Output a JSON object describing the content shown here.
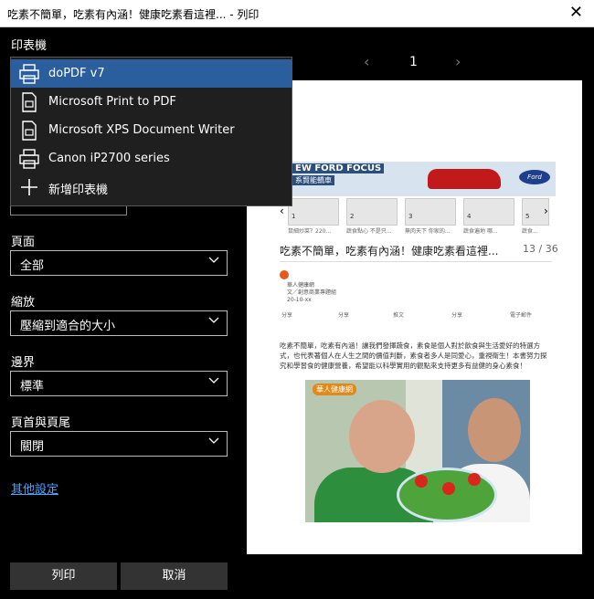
{
  "window": {
    "title": "吃素不簡單，吃素有內涵！健康吃素看這裡... - 列印",
    "close_glyph": "✕"
  },
  "left": {
    "printer_label": "印表機",
    "pages_label": "頁面",
    "pages_value": "全部",
    "scale_label": "縮放",
    "scale_value": "壓縮到適合的大小",
    "margins_label": "邊界",
    "margins_value": "標準",
    "header_footer_label": "頁首與頁尾",
    "header_footer_value": "關閉",
    "more_settings": "其他設定",
    "print_button": "列印",
    "cancel_button": "取消"
  },
  "printers": [
    {
      "name": "doPDF v7",
      "icon": "printer-icon",
      "selected": true
    },
    {
      "name": "Microsoft Print to PDF",
      "icon": "document-printer-icon",
      "selected": false
    },
    {
      "name": "Microsoft XPS Document Writer",
      "icon": "document-printer-icon",
      "selected": false
    },
    {
      "name": "Canon iP2700 series",
      "icon": "printer-icon",
      "selected": false
    },
    {
      "name": "新增印表機",
      "icon": "plus-icon",
      "selected": false
    }
  ],
  "preview": {
    "page_number": "1",
    "prev_glyph": "‹",
    "next_glyph": "›",
    "banner_title": "EW FORD FOCUS",
    "banner_sub": "系賢能轎車",
    "banner_logo": "Ford",
    "thumbs": [
      "1",
      "2",
      "3",
      "4",
      "5"
    ],
    "thumb_captions": [
      "鼠細炒菜？220...",
      "蔬食點心 不是只...",
      "無肉天下 你家的...",
      "蔬食遍地 哪...",
      "蔬食..."
    ],
    "headline": "吃素不簡單，吃素有內涵！健康吃素看這裡...",
    "page_count": "13 / 36",
    "author_lines": [
      "華人健康網",
      "文／創意商業專題組",
      "20-10-xx"
    ],
    "share_items": [
      "分享",
      "分享",
      "推文",
      "分享",
      "電子郵件"
    ],
    "body_text": "吃素不簡單，吃素有內涵！讓我們發揮蔬食，素食是個人對於飲食與生活愛好的特選方式，也代表著個人在人生之間的價值判斷，素食者多人是同愛心，重視衛生！本書努力探究和學習食的健康營養，希望能以科學實用的觀點來支持更多有益健的身心素食！",
    "photo_tag": "華人健康網"
  }
}
